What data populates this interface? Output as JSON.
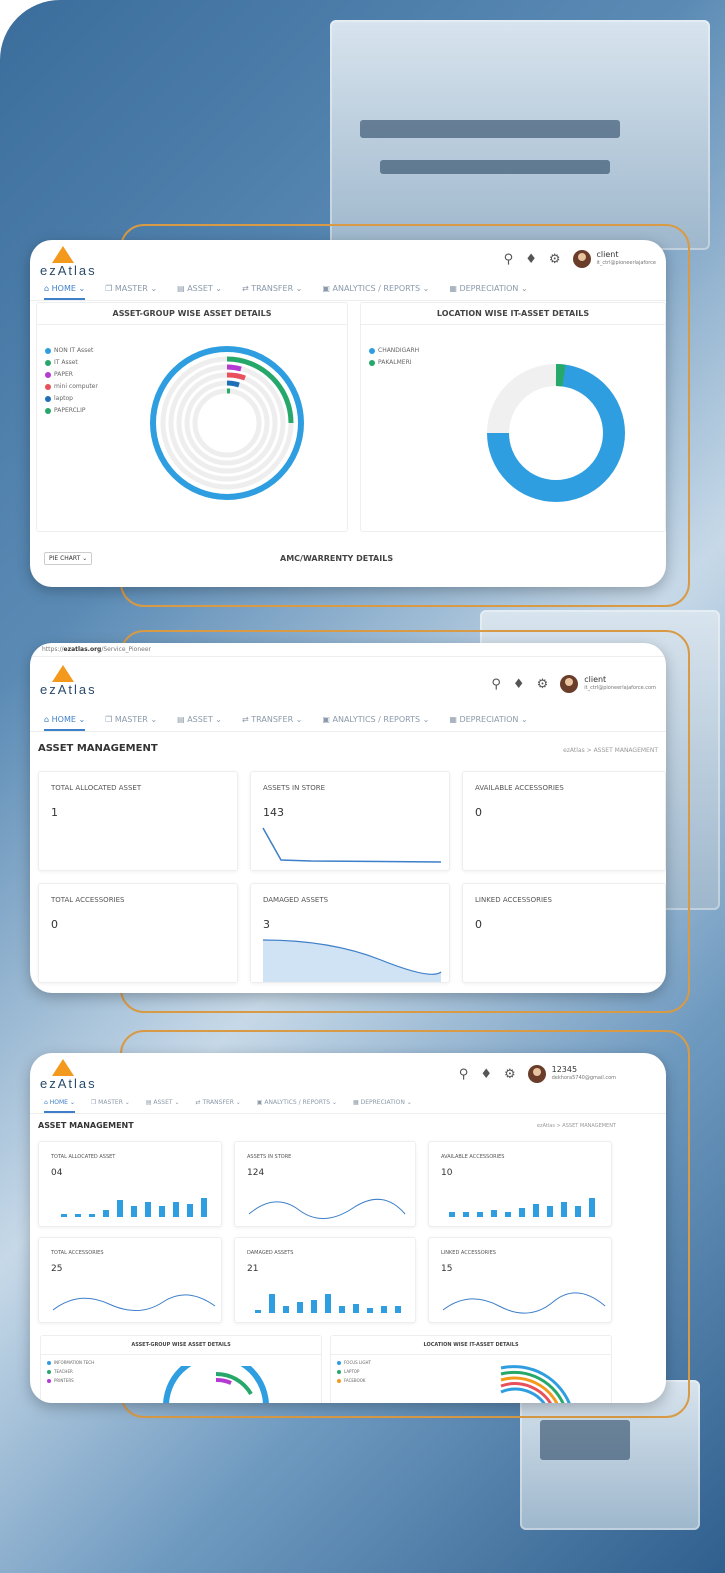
{
  "colors": {
    "primary": "#3d7fc9",
    "blue": "#2f9ee0",
    "green": "#27a86b",
    "purple": "#b33bd1",
    "red": "#e8505b",
    "orange": "#f39a1e",
    "outline": "#d89a45"
  },
  "brand": "ezAtlas",
  "screen1": {
    "user": {
      "name": "client",
      "email": "it_ctrl@pioneerlajaforce"
    },
    "nav": [
      "HOME",
      "MASTER",
      "ASSET",
      "TRANSFER",
      "ANALYTICS / REPORTS",
      "DEPRECIATION"
    ],
    "panel_left": {
      "title": "ASSET-GROUP WISE ASSET DETAILS",
      "legend": [
        "NON IT Asset",
        "IT Asset",
        "PAPER",
        "mini computer",
        "laptop",
        "PAPERCLIP"
      ]
    },
    "panel_right": {
      "title": "LOCATION WISE IT-ASSET DETAILS",
      "legend": [
        "CHANDIGARH",
        "PAKALMERI"
      ]
    },
    "select": "PIE CHART",
    "amc_title": "AMC/WARRENTY DETAILS",
    "icons": [
      "search-icon",
      "bell-icon",
      "gear-icon"
    ]
  },
  "screen2": {
    "url_prefix": "https://",
    "url_host": "ezatlas.org",
    "url_path": "/Service_Pioneer",
    "user": {
      "name": "client",
      "email": "it_ctrl@pioneerlajaforce.com"
    },
    "nav": [
      "HOME",
      "MASTER",
      "ASSET",
      "TRANSFER",
      "ANALYTICS / REPORTS",
      "DEPRECIATION"
    ],
    "page_title": "ASSET MANAGEMENT",
    "breadcrumb": "ezAtlas  >  ASSET MANAGEMENT",
    "cards": [
      {
        "label": "TOTAL ALLOCATED ASSET",
        "value": "1"
      },
      {
        "label": "ASSETS IN STORE",
        "value": "143"
      },
      {
        "label": "AVAILABLE ACCESSORIES",
        "value": "0"
      },
      {
        "label": "TOTAL ACCESSORIES",
        "value": "0"
      },
      {
        "label": "DAMAGED ASSETS",
        "value": "3"
      },
      {
        "label": "LINKED ACCESSORIES",
        "value": "0"
      }
    ]
  },
  "screen3": {
    "user": {
      "name": "12345",
      "email": "dekhora5740@gmail.com"
    },
    "nav": [
      "HOME",
      "MASTER",
      "ASSET",
      "TRANSFER",
      "ANALYTICS / REPORTS",
      "DEPRECIATION"
    ],
    "page_title": "ASSET MANAGEMENT",
    "breadcrumb": "ezAtlas  >  ASSET MANAGEMENT",
    "cards": [
      {
        "label": "TOTAL ALLOCATED ASSET",
        "value": "04"
      },
      {
        "label": "ASSETS IN STORE",
        "value": "124"
      },
      {
        "label": "AVAILABLE ACCESSORIES",
        "value": "10"
      },
      {
        "label": "TOTAL ACCESSORIES",
        "value": "25"
      },
      {
        "label": "DAMAGED ASSETS",
        "value": "21"
      },
      {
        "label": "LINKED ACCESSORIES",
        "value": "15"
      }
    ],
    "panel_left": {
      "title": "ASSET-GROUP WISE ASSET DETAILS",
      "legend": [
        "INFORMATION TECH",
        "TEACHER",
        "PRINTERS"
      ]
    },
    "panel_right": {
      "title": "LOCATION WISE IT-ASSET DETAILS",
      "legend": [
        "FOCUS LIGHT",
        "LAPTOP",
        "FACEBOOK"
      ]
    }
  }
}
